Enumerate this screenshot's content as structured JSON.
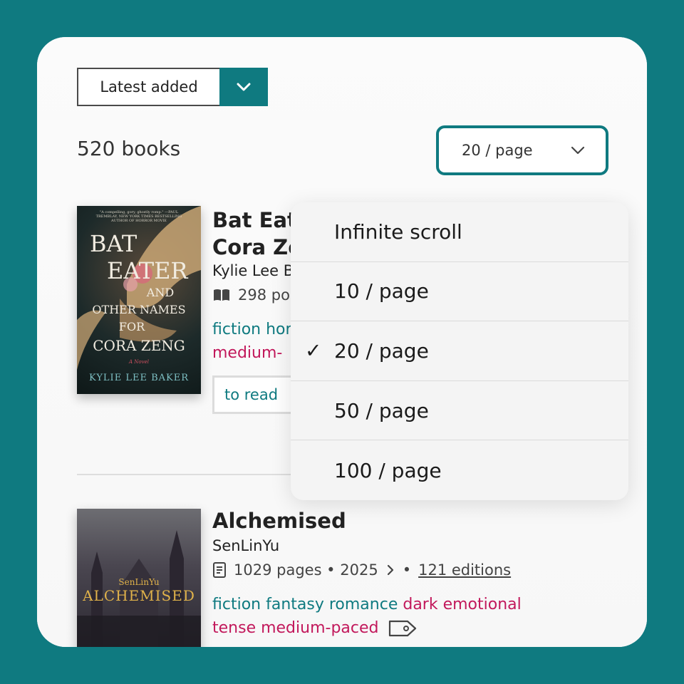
{
  "sort": {
    "label": "Latest added"
  },
  "results": {
    "count_label": "520 books"
  },
  "per_page": {
    "selected_label": "20 / page",
    "options": [
      "Infinite scroll",
      "10 / page",
      "20 / page",
      "50 / page",
      "100 / page"
    ],
    "selected_index": 2,
    "checkmark": "✓"
  },
  "books": [
    {
      "title_line1": "Bat Eat",
      "title_line2": "Cora Ze",
      "author": "Kylie Lee B",
      "pages": "298 po",
      "tags_line1": {
        "genre": "fiction hor"
      },
      "tags_line2": {
        "mood": "medium-"
      },
      "status": "to read",
      "cover": {
        "blurb": "\"A compelling, gory, ghostly romp.\" —PAUL TREMBLAY, NEW YORK TIMES BESTSELLING AUTHOR OF HORROR MOVIE",
        "line1": "BAT",
        "line2": "EATER",
        "line3": "AND",
        "line4": "OTHER NAMES",
        "line5": "FOR",
        "line6": "CORA ZENG",
        "tagline": "A Novel",
        "author": "KYLIE LEE BAKER"
      }
    },
    {
      "title": "Alchemised",
      "author": "SenLinYu",
      "meta": "1029 pages • 2025",
      "sep": "•",
      "editions": "121 editions",
      "tags_line1": {
        "genre": "fiction fantasy romance",
        "mood": "dark emotional"
      },
      "tags_line2": {
        "mood": "tense medium-paced"
      },
      "cover": {
        "author": "SenLinYu",
        "title": "ALCHEMISED"
      }
    }
  ],
  "colors": {
    "accent": "#0f7a80",
    "mood": "#c2185b",
    "background": "#0f7a80"
  }
}
